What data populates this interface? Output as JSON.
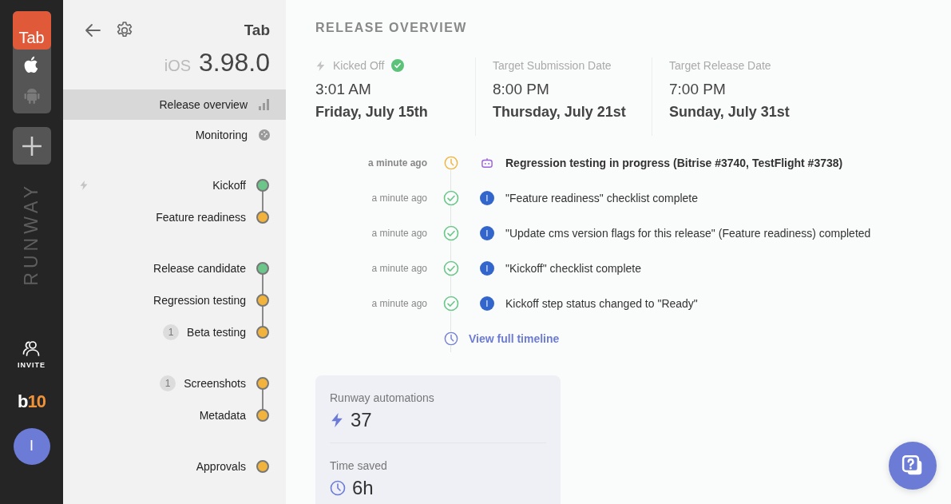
{
  "rail": {
    "app_tile": {
      "label": "Tab"
    },
    "platforms": [
      {
        "kind": "apple",
        "selected": true
      },
      {
        "kind": "android",
        "selected": false
      }
    ],
    "brand": "RUNWAY",
    "invite": {
      "label": "INVITE"
    },
    "workspace_logo": {
      "text": "b",
      "accent": "10"
    },
    "avatar": {
      "initial": "I"
    }
  },
  "sidebar": {
    "app_name": "Tab",
    "platform": "iOS",
    "version": "3.98.0",
    "nav": [
      {
        "label": "Release overview",
        "kind": "chart",
        "selected": true
      },
      {
        "label": "Monitoring",
        "kind": "gauge",
        "selected": false
      }
    ],
    "step_groups": [
      {
        "automated": true,
        "steps": [
          {
            "label": "Kickoff",
            "color": "#6cc68a"
          },
          {
            "label": "Feature readiness",
            "color": "#f2b33d"
          }
        ]
      },
      {
        "automated": false,
        "steps": [
          {
            "label": "Release candidate",
            "color": "#6cc68a"
          },
          {
            "label": "Regression testing",
            "color": "#f2b33d"
          },
          {
            "label": "Beta testing",
            "color": "#f2b33d",
            "badge": "1"
          }
        ]
      },
      {
        "automated": false,
        "steps": [
          {
            "label": "Screenshots",
            "color": "#f2b33d",
            "badge": "1"
          },
          {
            "label": "Metadata",
            "color": "#f2b33d"
          }
        ]
      },
      {
        "automated": false,
        "steps": [
          {
            "label": "Approvals",
            "color": "#f2b33d"
          }
        ]
      }
    ]
  },
  "main": {
    "title": "RELEASE OVERVIEW",
    "dates": [
      {
        "kind": "kickoff",
        "label": "Kicked Off",
        "done": true,
        "time": "3:01 AM",
        "date": "Friday, July 15th"
      },
      {
        "kind": "target",
        "label": "Target Submission Date",
        "time": "8:00 PM",
        "date": "Thursday, July 21st"
      },
      {
        "kind": "target",
        "label": "Target Release Date",
        "time": "7:00 PM",
        "date": "Sunday, July 31st"
      }
    ],
    "timeline": [
      {
        "time": "a minute ago",
        "completed": false,
        "kind": "bot",
        "text": "Regression testing in progress (Bitrise #3740, TestFlight #3738)"
      },
      {
        "time": "a minute ago",
        "completed": true,
        "kind": "user",
        "initial": "I",
        "text": "\"Feature readiness\" checklist complete"
      },
      {
        "time": "a minute ago",
        "completed": true,
        "kind": "user",
        "initial": "I",
        "text": "\"Update cms version flags for this release\" (Feature readiness) completed"
      },
      {
        "time": "a minute ago",
        "completed": true,
        "kind": "user",
        "initial": "I",
        "text": "\"Kickoff\" checklist complete"
      },
      {
        "time": "a minute ago",
        "completed": true,
        "kind": "user",
        "initial": "I",
        "text": "Kickoff step status changed to \"Ready\""
      }
    ],
    "timeline_link": "View full timeline",
    "stats": [
      {
        "kind": "bolt",
        "label": "Runway automations",
        "value": "37"
      },
      {
        "kind": "clock",
        "label": "Time saved",
        "value": "6h"
      }
    ]
  }
}
